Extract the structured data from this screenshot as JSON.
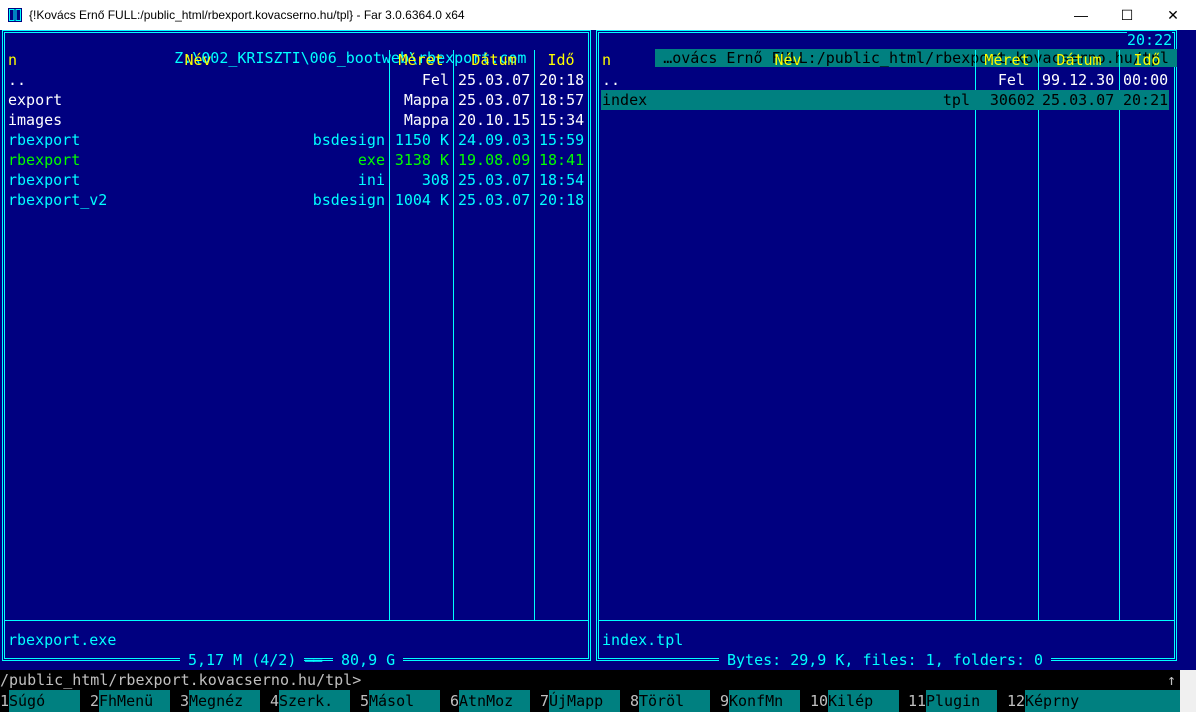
{
  "window": {
    "title": "{!Kovács Ernő FULL:/public_html/rbexport.kovacserno.hu/tpl} - Far 3.0.6364.0 x64",
    "minimize": "—",
    "maximize": "☐",
    "close": "✕"
  },
  "left_panel": {
    "title": "Z:\\002_KRISZTI\\006_bootweb\\rbexport.com",
    "headers": {
      "n": "n",
      "name": "Név",
      "size": "Méret",
      "date": "Dátum",
      "time": "Idő"
    },
    "rows": [
      {
        "name": "..",
        "ext": "",
        "size": "Fel",
        "date": "25.03.07",
        "time": "20:18",
        "color": "white"
      },
      {
        "name": "export",
        "ext": "",
        "size": "Mappa",
        "date": "25.03.07",
        "time": "18:57",
        "color": "white"
      },
      {
        "name": "images",
        "ext": "",
        "size": "Mappa",
        "date": "20.10.15",
        "time": "15:34",
        "color": "white"
      },
      {
        "name": "rbexport",
        "ext": "bsdesign",
        "size": "1150 K",
        "date": "24.09.03",
        "time": "15:59",
        "color": "cyan"
      },
      {
        "name": "rbexport",
        "ext": "exe",
        "size": "3138 K",
        "date": "19.08.09",
        "time": "18:41",
        "color": "green"
      },
      {
        "name": "rbexport",
        "ext": "ini",
        "size": "308",
        "date": "25.03.07",
        "time": "18:54",
        "color": "cyan"
      },
      {
        "name": "rbexport_v2",
        "ext": "bsdesign",
        "size": "1004 K",
        "date": "25.03.07",
        "time": "20:18",
        "color": "cyan"
      }
    ],
    "current_file": "rbexport.exe",
    "status": "5,17 M (4/2)",
    "free": "80,9 G"
  },
  "right_panel": {
    "title": "…ovács Ernő FULL:/public_html/rbexport.kovacserno.hu/tpl",
    "clock": "20:22",
    "headers": {
      "n": "n",
      "name": "Név",
      "size": "Méret",
      "date": "Dátum",
      "time": "Idő"
    },
    "rows": [
      {
        "name": "..",
        "ext": "",
        "size": "Fel",
        "date": "99.12.30",
        "time": "00:00",
        "color": "white"
      },
      {
        "name": "index",
        "ext": "tpl",
        "size": "30602",
        "date": "25.03.07",
        "time": "20:21",
        "color": "sel"
      }
    ],
    "current_file": "index.tpl",
    "status": "Bytes: 29,9 K, files: 1, folders: 0"
  },
  "command_line": {
    "prompt": "/public_html/rbexport.kovacserno.hu/tpl>",
    "scroll_up": "↑"
  },
  "keybar": [
    {
      "num": "1",
      "label": "Súgó"
    },
    {
      "num": "2",
      "label": "FhMenü"
    },
    {
      "num": "3",
      "label": "Megnéz"
    },
    {
      "num": "4",
      "label": "Szerk."
    },
    {
      "num": "5",
      "label": "Másol"
    },
    {
      "num": "6",
      "label": "AtnMoz"
    },
    {
      "num": "7",
      "label": "ÚjMapp"
    },
    {
      "num": "8",
      "label": "Töröl"
    },
    {
      "num": "9",
      "label": "KonfMn"
    },
    {
      "num": "10",
      "label": "Kilép"
    },
    {
      "num": "11",
      "label": "Plugin"
    },
    {
      "num": "12",
      "label": "Képrny"
    }
  ],
  "colors": {
    "panel_bg": "#000080",
    "frame": "#00ffff",
    "header": "#ffff00",
    "selection": "#008080",
    "executable": "#00ff00"
  }
}
